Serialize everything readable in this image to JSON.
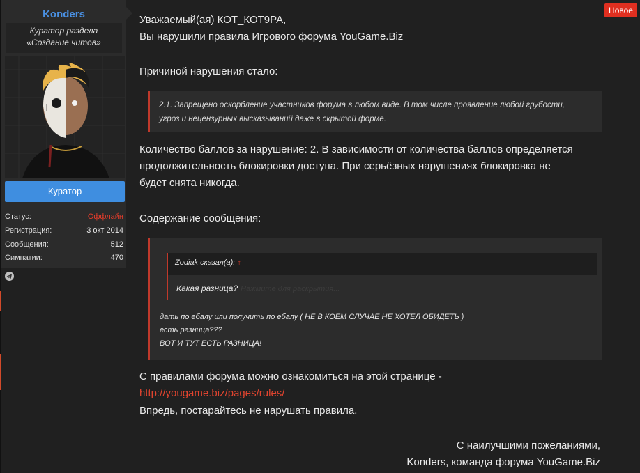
{
  "badge": "Новое",
  "sidebar": {
    "username": "Konders",
    "title_line1": "Куратор раздела",
    "title_line2": "«Создание читов»",
    "role_button": "Куратор",
    "stats": [
      {
        "label": "Статус:",
        "value": "Оффлайн"
      },
      {
        "label": "Регистрация:",
        "value": "3 окт 2014"
      },
      {
        "label": "Сообщения:",
        "value": "512"
      },
      {
        "label": "Симпатии:",
        "value": "470"
      }
    ]
  },
  "message": {
    "greeting": "Уважаемый(ая) КОТ_КОТ9РА,",
    "violation": "Вы нарушили правила Игрового форума YouGame.Biz",
    "reason_label": "Причиной нарушения стало:",
    "rule_line1": "2.1. Запрещено оскорбление участников форума в любом виде. В том числе проявление любой грубости,",
    "rule_line2": "угроз и нецензурных высказываний даже в скрытой форме.",
    "points_line1": "Количество баллов за нарушение: 2. В зависимости от количества баллов определяется",
    "points_line2": "продолжительность блокировки доступа. При серьёзных нарушениях блокировка не",
    "points_line3": "будет снята никогда.",
    "content_label": "Содержание сообщения:",
    "inner_quote_author": "Zodiak сказал(а):",
    "inner_quote_arrow": "↑",
    "inner_quote_text": "Какая разница?",
    "inner_quote_faded": "Нажмите для раскрытия...",
    "quoted_line1": "дать по ебалу или получить по ебалу ( НЕ В КОЕМ СЛУЧАЕ НЕ ХОТЕЛ ОБИДЕТЬ )",
    "quoted_line2": "есть разница???",
    "quoted_line3": "ВОТ И ТУТ ЕСТЬ РАЗНИЦА!",
    "rules_intro": "С правилами форума можно ознакомиться на этой странице -",
    "rules_link": "http://yougame.biz/pages/rules/",
    "advice": "Впредь, постарайтесь не нарушать правила.",
    "sign_line1": "С наилучшими пожеланиями,",
    "sign_line2": "Konders, команда форума YouGame.Biz"
  }
}
